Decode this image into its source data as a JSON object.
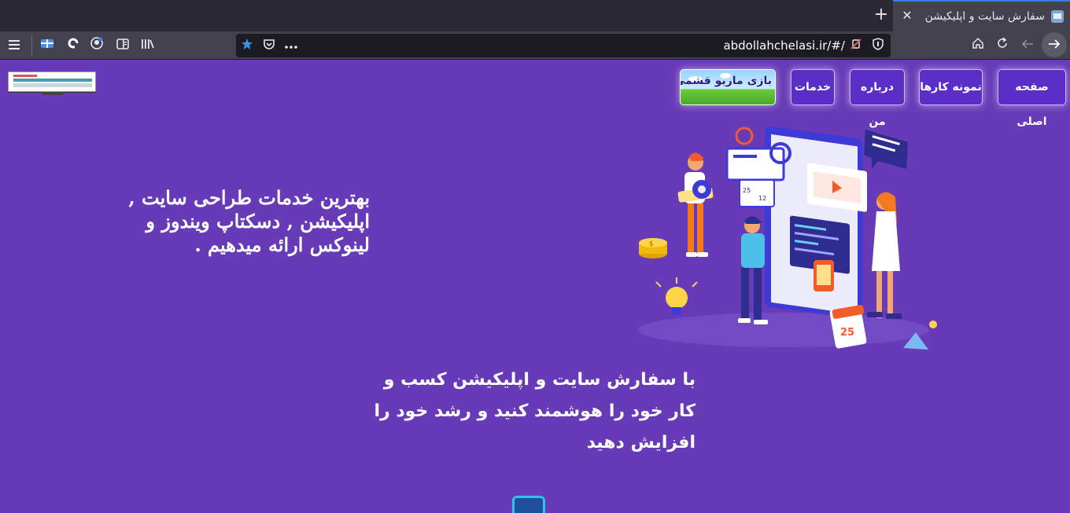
{
  "browser": {
    "tab_title": "سفارش سایت و اپلیکیشن",
    "tab_close": "✕",
    "new_tab": "+",
    "url": "abdollahchelasi.ir/#/",
    "toolbar_icons": [
      "menu-icon",
      "extension-icon",
      "circle-icon",
      "account-icon",
      "sidebar-icon",
      "library-icon"
    ],
    "url_icons": [
      "star-icon",
      "pocket-icon",
      "more-icon",
      "tracking-off-icon",
      "shield-icon"
    ],
    "nav_icons": [
      "home-icon",
      "reload-icon",
      "back-icon",
      "forward-icon"
    ]
  },
  "site": {
    "nav": {
      "home": "صفحه اصلی",
      "portfolio": "نمونه کارها",
      "about": "درباره من",
      "services": "خدمات",
      "mario": "بازی ماریو قشمی"
    },
    "hero": {
      "headline": "بهترین خدمات طراحی سایت , اپلیکیشن , دسکتاپ ویندوز و لینوکس ارائه میدهیم .",
      "subline": "با سفارش سایت و اپلیکیشن کسب و کار خود را هوشمند کنید و رشد خود را افزایش دهید"
    },
    "illustration": {
      "calendar_number": "25",
      "coin_symbol": "$",
      "likes": "25",
      "comments": "12"
    },
    "colors": {
      "background": "#673ab7",
      "nav_button": "#5b2fc7"
    }
  }
}
